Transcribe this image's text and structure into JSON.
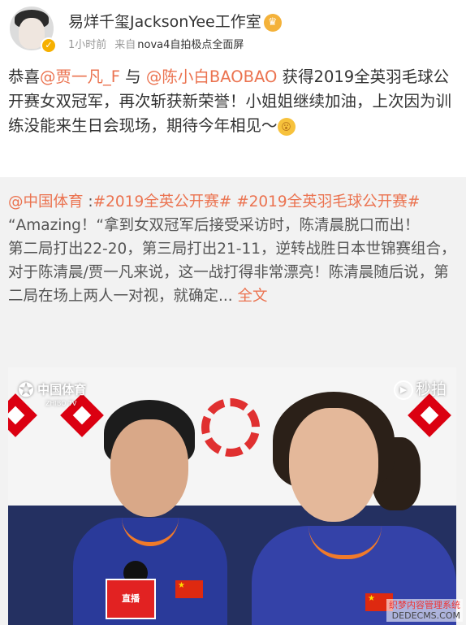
{
  "author": {
    "name": "易烊千玺JacksonYee工作室",
    "verified_icon": "verified-badge-icon",
    "badge_icon": "crown-emoji-icon"
  },
  "meta": {
    "time": "1小时前",
    "source_prefix": "来自",
    "device": "nova4自拍极点全面屏"
  },
  "post": {
    "intro": "恭喜",
    "mention1": "@贾一凡_F",
    "connector": " 与 ",
    "mention2": "@陈小白BAOBAO",
    "body": " 获得2019全英羽毛球公开赛女双冠军，再次斩获新荣誉！小姐姐继续加油，上次因为训练没能来生日会现场，期待今年相见～",
    "emoji": "surprised-face-emoji"
  },
  "repost": {
    "source_mention": "@中国体育",
    "separator": " :",
    "topic1": "#2019全英公开赛#",
    "topic2": "#2019全英羽毛球公开赛#",
    "line1": "“Amazing！“拿到女双冠军后接受采访时，陈清晨脱口而出！",
    "line2": "第二局打出22-20，第三局打出21-11，逆转战胜日本世锦赛组合，对于陈清晨/贾一凡来说，这一战打得非常漂亮！陈清晨随后说，第二局在场上两人一对视，就确定...",
    "full_text_label": "全文"
  },
  "video": {
    "channel_watermark": "中国体育",
    "channel_watermark_sub": "ZHIBO TV",
    "platform_watermark": "秒拍",
    "mic_label": "直播"
  },
  "site_watermark": {
    "line1": "织梦内容管理系统",
    "line2": "DEDECMS.COM"
  },
  "colors": {
    "accent": "#eb7350",
    "repost_bg": "#f2f2f2",
    "meta_text": "#999999"
  }
}
